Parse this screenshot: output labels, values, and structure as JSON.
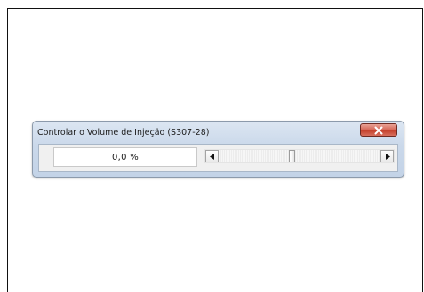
{
  "dialog": {
    "title": "Controlar o Volume de Injeção (S307-28)",
    "close_icon": "close-icon",
    "value_display": "0,0 %",
    "scrollbar": {
      "left_icon": "arrow-left-icon",
      "right_icon": "arrow-right-icon",
      "position_fraction": 0.45
    }
  },
  "colors": {
    "titlebar": "#cad8ea",
    "close_button": "#c5412c",
    "client_background": "#f0f0f0"
  }
}
